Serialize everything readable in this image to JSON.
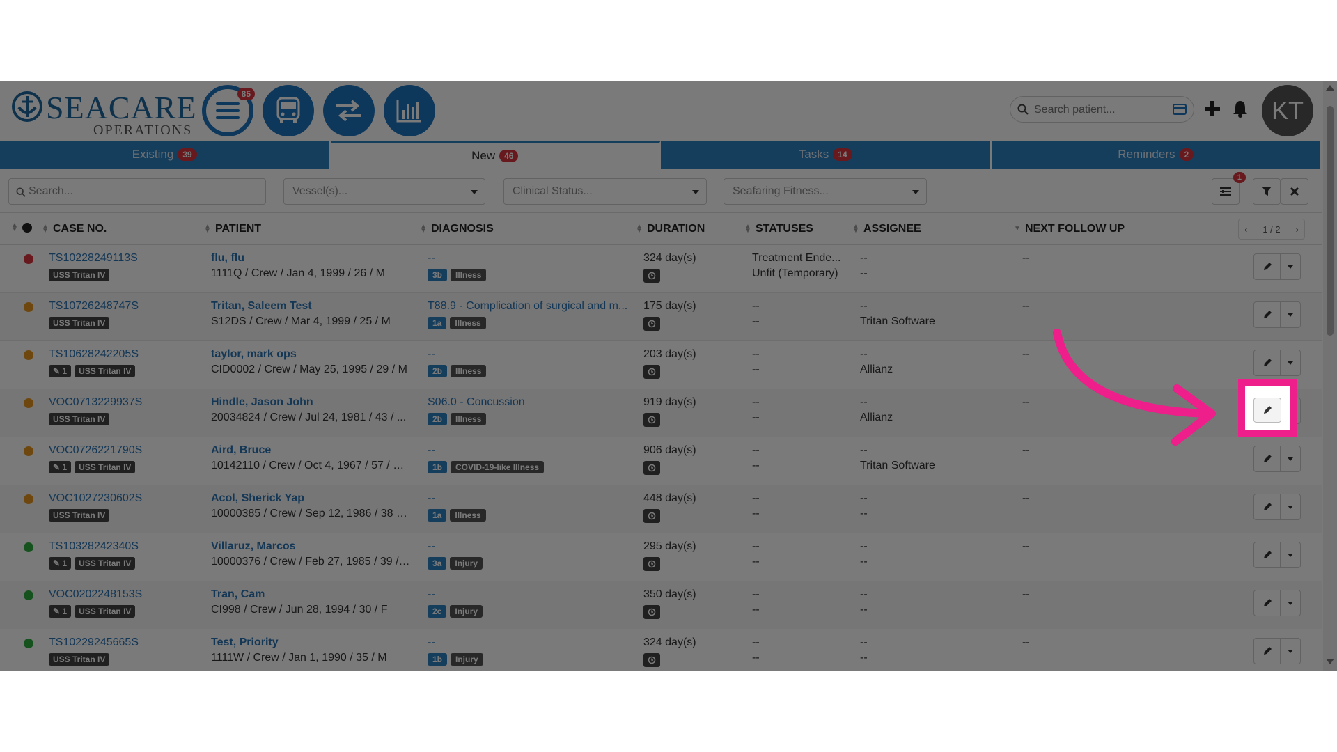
{
  "brand": {
    "name": "SEACARE",
    "sub": "OPERATIONS"
  },
  "nav": {
    "menu_badge": "85"
  },
  "search_patient": {
    "placeholder": "Search patient..."
  },
  "user": {
    "initials": "KT"
  },
  "tabs": [
    {
      "label": "Existing",
      "badge": "39"
    },
    {
      "label": "New",
      "badge": "46"
    },
    {
      "label": "Tasks",
      "badge": "14"
    },
    {
      "label": "Reminders",
      "badge": "2"
    }
  ],
  "filters": {
    "search": "Search...",
    "vessels": "Vessel(s)...",
    "clinical": "Clinical Status...",
    "fitness": "Seafaring Fitness...",
    "settings_badge": "1"
  },
  "columns": {
    "case": "CASE NO.",
    "patient": "PATIENT",
    "diagnosis": "DIAGNOSIS",
    "duration": "DURATION",
    "statuses": "STATUSES",
    "assignee": "ASSIGNEE",
    "followup": "NEXT FOLLOW UP"
  },
  "pager": {
    "prev": "‹",
    "label": "1 / 2",
    "next": "›"
  },
  "colors": {
    "red": "#d9363e",
    "orange": "#e69520",
    "green": "#2eab3f",
    "accent": "#2d7fc0",
    "highlight": "#ee1e8a"
  },
  "rows": [
    {
      "status": "red",
      "case": "TS10228249113S",
      "tags": [
        "USS Tritan IV"
      ],
      "name": "flu, flu",
      "info": "1111Q / Crew / Jan 4, 1999 / 26 / M",
      "diag": "--",
      "cat": "3b",
      "kind": "Illness",
      "dur": "324 day(s)",
      "s1": "Treatment Ende...",
      "s2": "Unfit (Temporary)",
      "a1": "--",
      "a2": "--",
      "fol": "--"
    },
    {
      "status": "orange",
      "case": "TS10726248747S",
      "tags": [
        "USS Tritan IV"
      ],
      "name": "Tritan, Saleem Test",
      "info": "S12DS / Crew / Mar 4, 1999 / 25 / M",
      "diag": "T88.9 - Complication of surgical and m...",
      "cat": "1a",
      "kind": "Illness",
      "dur": "175 day(s)",
      "s1": "--",
      "s2": "--",
      "a1": "--",
      "a2": "Tritan Software",
      "fol": "--"
    },
    {
      "status": "orange",
      "case": "TS10628242205S",
      "tags": [
        "✎ 1",
        "USS Tritan IV"
      ],
      "name": "taylor, mark ops",
      "info": "CID0002 / Crew / May 25, 1995 / 29 / M",
      "diag": "--",
      "cat": "2b",
      "kind": "Illness",
      "dur": "203 day(s)",
      "s1": "--",
      "s2": "--",
      "a1": "--",
      "a2": "Allianz",
      "fol": "--"
    },
    {
      "status": "orange",
      "case": "VOC0713229937S",
      "tags": [
        "USS Tritan IV"
      ],
      "name": "Hindle, Jason John",
      "info": "20034824 / Crew / Jul 24, 1981 / 43 / ...",
      "diag": "S06.0 - Concussion",
      "cat": "2b",
      "kind": "Illness",
      "dur": "919 day(s)",
      "s1": "--",
      "s2": "--",
      "a1": "--",
      "a2": "Allianz",
      "fol": "--"
    },
    {
      "status": "orange",
      "case": "VOC0726221790S",
      "tags": [
        "✎ 1",
        "USS Tritan IV"
      ],
      "name": "Aird, Bruce",
      "info": "10142110 / Crew / Oct 4, 1967 / 57 / M...",
      "diag": "--",
      "cat": "1b",
      "kind": "COVID-19-like Illness",
      "dur": "906 day(s)",
      "s1": "--",
      "s2": "--",
      "a1": "--",
      "a2": "Tritan Software",
      "fol": "--"
    },
    {
      "status": "orange",
      "case": "VOC1027230602S",
      "tags": [
        "USS Tritan IV"
      ],
      "name": "Acol, Sherick Yap",
      "info": "10000385 / Crew / Sep 12, 1986 / 38 / ...",
      "diag": "--",
      "cat": "1a",
      "kind": "Illness",
      "dur": "448 day(s)",
      "s1": "--",
      "s2": "--",
      "a1": "--",
      "a2": "--",
      "fol": "--"
    },
    {
      "status": "green",
      "case": "TS10328242340S",
      "tags": [
        "✎ 1",
        "USS Tritan IV"
      ],
      "name": "Villaruz, Marcos",
      "info": "10000376 / Crew / Feb 27, 1985 / 39 / ...",
      "diag": "--",
      "cat": "3a",
      "kind": "Injury",
      "dur": "295 day(s)",
      "s1": "--",
      "s2": "--",
      "a1": "--",
      "a2": "--",
      "fol": "--"
    },
    {
      "status": "green",
      "case": "VOC0202248153S",
      "tags": [
        "✎ 1",
        "USS Tritan IV"
      ],
      "name": "Tran, Cam",
      "info": "CI998 / Crew / Jun 28, 1994 / 30 / F",
      "diag": "--",
      "cat": "2c",
      "kind": "Injury",
      "dur": "350 day(s)",
      "s1": "--",
      "s2": "--",
      "a1": "--",
      "a2": "--",
      "fol": "--"
    },
    {
      "status": "green",
      "case": "TS10229245665S",
      "tags": [
        "USS Tritan IV"
      ],
      "name": "Test, Priority",
      "info": "1111W / Crew / Jan 1, 1990 / 35 / M",
      "diag": "--",
      "cat": "1b",
      "kind": "Injury",
      "dur": "324 day(s)",
      "s1": "--",
      "s2": "--",
      "a1": "--",
      "a2": "--",
      "fol": "--"
    }
  ]
}
